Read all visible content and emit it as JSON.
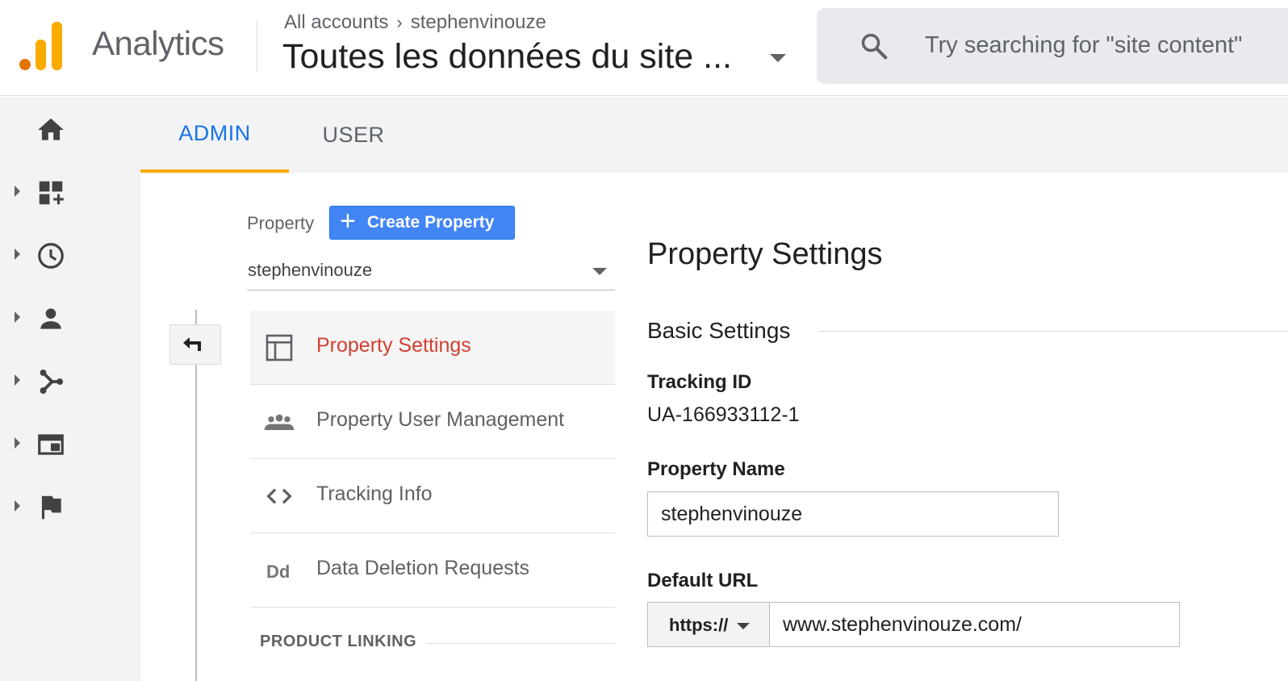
{
  "header": {
    "app_name": "Analytics",
    "breadcrumb": {
      "account": "All accounts",
      "property": "stephenvinouze"
    },
    "view_title": "Toutes les données du site ...",
    "search_placeholder": "Try searching for \"site content\""
  },
  "left_nav": {
    "items": [
      {
        "icon": "home-icon"
      },
      {
        "icon": "customization-icon"
      },
      {
        "icon": "realtime-clock-icon"
      },
      {
        "icon": "audience-person-icon"
      },
      {
        "icon": "acquisition-icon"
      },
      {
        "icon": "behavior-icon"
      },
      {
        "icon": "conversions-flag-icon"
      }
    ]
  },
  "tabs": [
    {
      "label": "ADMIN",
      "active": true
    },
    {
      "label": "USER",
      "active": false
    }
  ],
  "property_column": {
    "label": "Property",
    "create_button": "Create Property",
    "selected_property": "stephenvinouze",
    "menu": [
      {
        "label": "Property Settings",
        "icon": "layout-icon",
        "active": true
      },
      {
        "label": "Property User Management",
        "icon": "users-group-icon",
        "active": false
      },
      {
        "label": "Tracking Info",
        "icon": "code-icon",
        "active": false
      },
      {
        "label": "Data Deletion Requests",
        "icon": "data-deletion-icon",
        "active": false
      }
    ],
    "section_product_linking": "PRODUCT LINKING"
  },
  "settings": {
    "title": "Property Settings",
    "basic_title": "Basic Settings",
    "tracking_id_label": "Tracking ID",
    "tracking_id_value": "UA-166933112-1",
    "property_name_label": "Property Name",
    "property_name_value": "stephenvinouze",
    "default_url_label": "Default URL",
    "url_scheme": "https://",
    "url_value": "www.stephenvinouze.com/"
  },
  "colors": {
    "accent_blue": "#1a73e8",
    "tab_indicator": "#f9ab00",
    "active_menu_text": "#d23f31",
    "logo_orange": "#e37400",
    "logo_yellow": "#f9ab00"
  }
}
